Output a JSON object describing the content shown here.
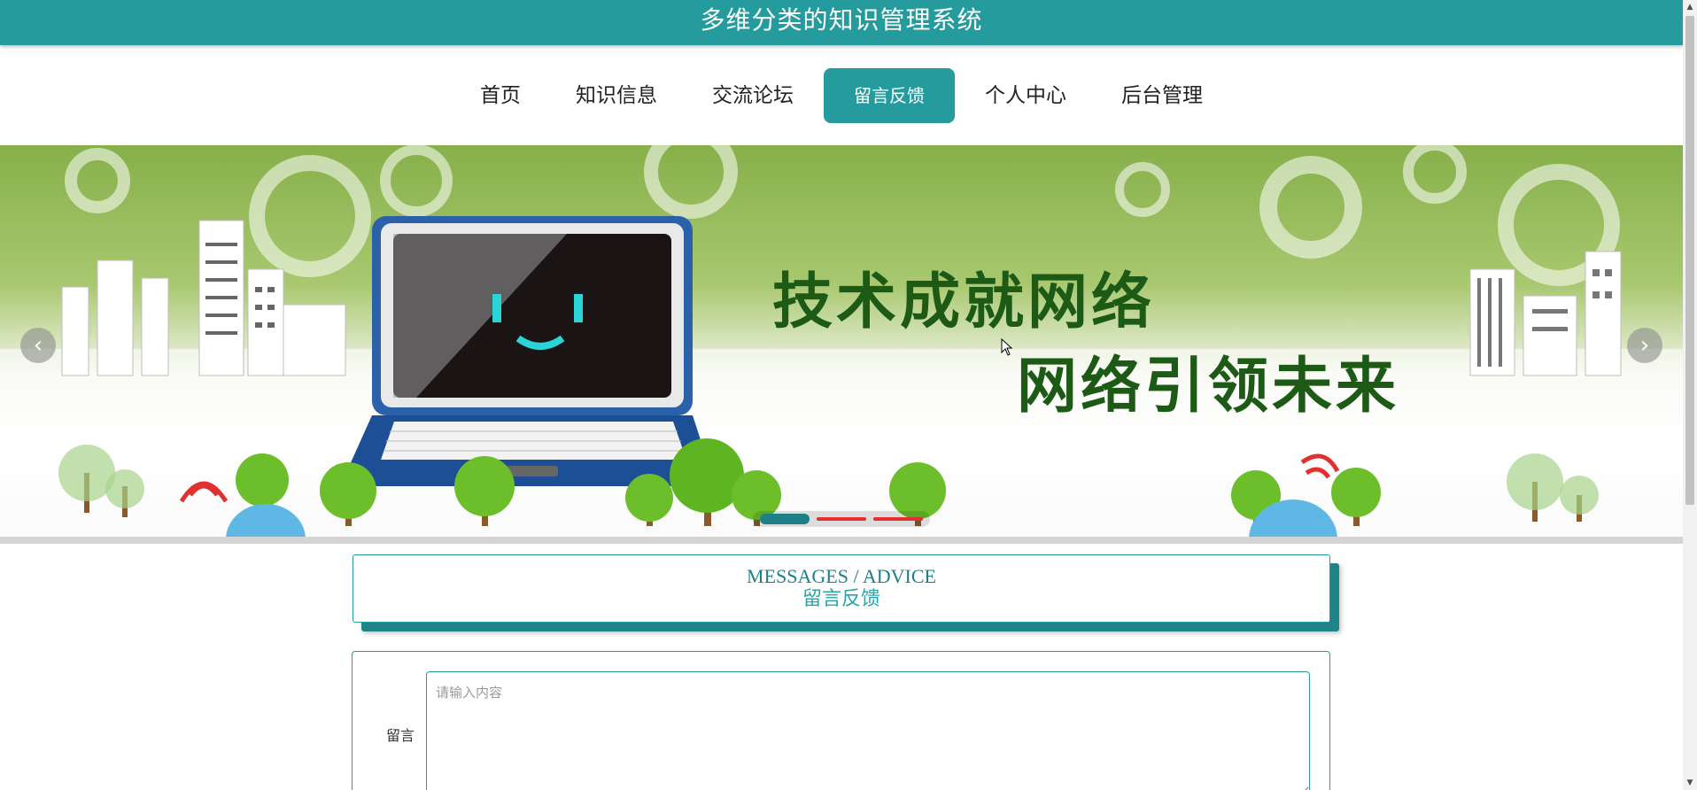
{
  "header": {
    "title": "多维分类的知识管理系统"
  },
  "nav": {
    "items": [
      {
        "label": "首页"
      },
      {
        "label": "知识信息"
      },
      {
        "label": "交流论坛"
      },
      {
        "label": "留言反馈"
      },
      {
        "label": "个人中心"
      },
      {
        "label": "后台管理"
      }
    ],
    "active_index": 3
  },
  "banner": {
    "line1": "技术成就网络",
    "line2": "网络引领未来",
    "slides": 3,
    "active_slide": 1,
    "prev_icon": "chevron-left-icon",
    "next_icon": "chevron-right-icon"
  },
  "section": {
    "title_en": "MESSAGES / ADVICE",
    "title_cn": "留言反馈"
  },
  "form": {
    "message_label": "留言",
    "message_placeholder": "请输入内容",
    "message_value": ""
  },
  "colors": {
    "primary": "#259b9e",
    "banner_green": "#86b04a",
    "indicator_active": "#1f7f86",
    "indicator_inactive": "#e03030"
  }
}
